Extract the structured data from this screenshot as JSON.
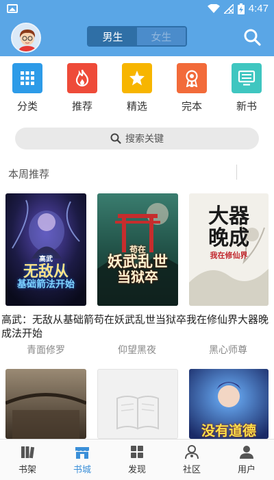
{
  "status_bar": {
    "time": "4:47"
  },
  "header": {
    "gender_tabs": [
      {
        "label": "男生",
        "active": true
      },
      {
        "label": "女生",
        "active": false
      }
    ]
  },
  "categories": [
    {
      "label": "分类",
      "icon": "grid-icon",
      "color": "#2d9be8"
    },
    {
      "label": "推荐",
      "icon": "fire-icon",
      "color": "#ee4b39"
    },
    {
      "label": "精选",
      "icon": "star-icon",
      "color": "#f7b500"
    },
    {
      "label": "完本",
      "icon": "medal-icon",
      "color": "#f26b3a"
    },
    {
      "label": "新书",
      "icon": "monitor-icon",
      "color": "#3fc6c0"
    }
  ],
  "search": {
    "placeholder": "搜索关键"
  },
  "section": {
    "title": "本周推荐"
  },
  "books": [
    {
      "title": "高武：无敌从基础箭法开始",
      "author": "青面修罗",
      "cover_text": [
        "高武",
        "无敌从",
        "基础箭法开始"
      ]
    },
    {
      "title": "苟在妖武乱世当狱卒",
      "author": "仰望黑夜",
      "cover_text": [
        "苟在",
        "妖武乱世",
        "当狱卒"
      ]
    },
    {
      "title": "我在修仙界大器晚成",
      "author": "黑心师尊",
      "cover_text": [
        "大器",
        "晚成",
        "我在修仙界"
      ]
    }
  ],
  "books_row_text": "高武：无敌从基础箭苟在妖武乱世当狱卒我在修仙界大器晚成法开始",
  "more_books": [
    {
      "cover_text": ""
    },
    {
      "cover_text": ""
    },
    {
      "cover_text": "没有道德"
    }
  ],
  "tabbar": [
    {
      "label": "书架",
      "icon": "bookshelf-icon",
      "active": false
    },
    {
      "label": "书城",
      "icon": "store-icon",
      "active": true
    },
    {
      "label": "发现",
      "icon": "discover-icon",
      "active": false
    },
    {
      "label": "社区",
      "icon": "community-icon",
      "active": false
    },
    {
      "label": "用户",
      "icon": "user-icon",
      "active": false
    }
  ],
  "colors": {
    "header": "#5aa6e6",
    "active_tab": "#3a8fd8"
  }
}
